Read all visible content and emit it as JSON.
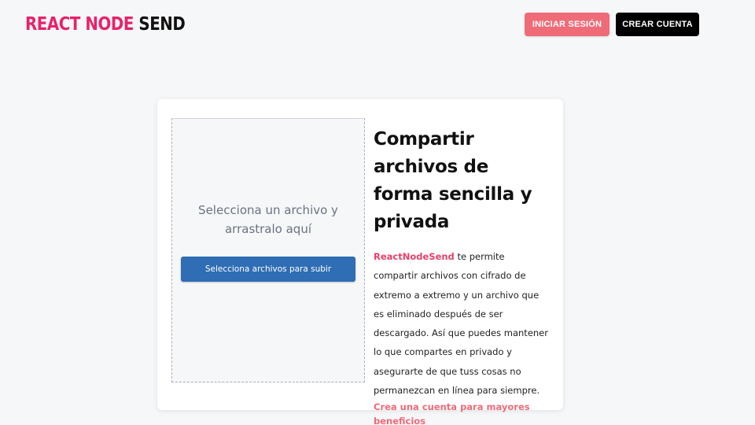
{
  "header": {
    "logo_part1": "REACT NODE",
    "logo_part2": "SEND",
    "login_label": "INICIAR SESIÓN",
    "signup_label": "CREAR CUENTA"
  },
  "upload": {
    "drop_text": "Selecciona un archivo y arrastralo aquí",
    "button_label": "Selecciona archivos para subir"
  },
  "info": {
    "heading": "Compartir archivos de forma sencilla y privada",
    "brand": "ReactNodeSend",
    "description": " te permite compartir archivos con cifrado de extremo a extremo y un archivo que es eliminado después de ser descargado. Así que puedes mantener lo que compartes en privado y asegurarte de que tuss cosas no permanezcan en línea para siempre.",
    "cta": "Crea una cuenta para mayores beneficios"
  },
  "colors": {
    "brand_pink": "#e8226a",
    "login_button": "#f06b78",
    "signup_button": "#000000",
    "upload_button": "#2f6db5",
    "background": "#f6f7f9"
  }
}
